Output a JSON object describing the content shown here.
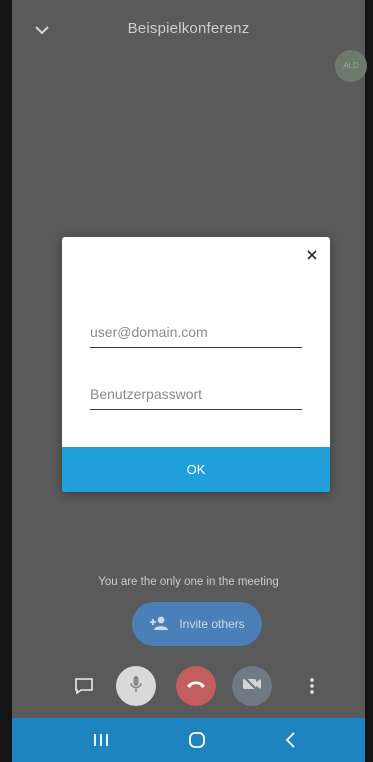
{
  "header": {
    "title": "Beispielkonferenz",
    "avatar_text": "ALD"
  },
  "dialog": {
    "username_placeholder": "user@domain.com",
    "password_placeholder": "Benutzerpasswort",
    "ok_label": "OK"
  },
  "meeting": {
    "status_text": "You are the only one in the meeting",
    "invite_label": "Invite others"
  },
  "icons": {
    "collapse": "chevron-down-icon",
    "close": "close-icon",
    "add_person": "person-add-icon",
    "chat": "chat-icon",
    "microphone": "microphone-icon",
    "hangup": "phone-hangup-icon",
    "camera_off": "camera-off-icon",
    "more": "more-vertical-icon",
    "recent_apps": "recent-apps-icon",
    "home": "home-icon",
    "back": "back-icon"
  },
  "colors": {
    "accent": "#209fda",
    "nav_bar": "#1d84c0",
    "hangup": "#c25e5e",
    "invite": "#4a7fb8"
  }
}
